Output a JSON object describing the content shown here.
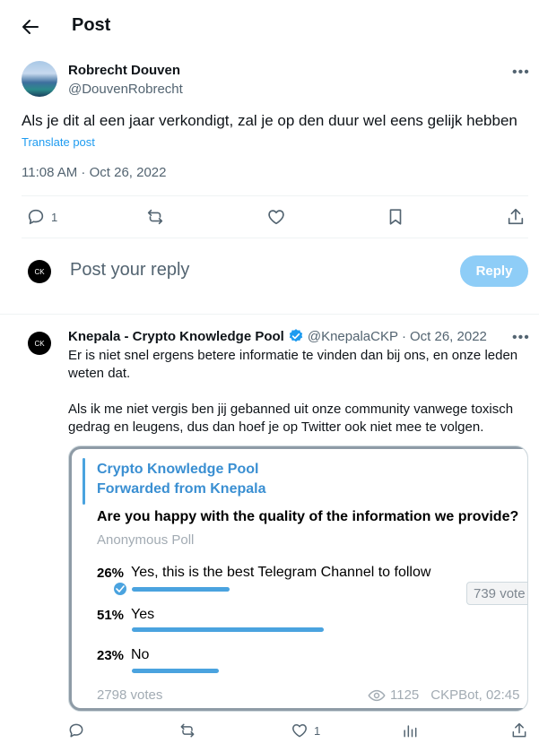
{
  "header": {
    "title": "Post"
  },
  "post": {
    "author_name": "Robrecht Douven",
    "author_handle": "@DouvenRobrecht",
    "text": "Als je dit al een jaar verkondigt, zal je op den duur wel eens gelijk hebben",
    "translate_label": "Translate post",
    "timestamp": "11:08 AM · Oct 26, 2022",
    "actions": {
      "reply_count": "1"
    }
  },
  "composer": {
    "avatar_text": "CK",
    "placeholder": "Post your reply",
    "reply_button": "Reply"
  },
  "reply": {
    "avatar_text": "CK",
    "name": "Knepala - Crypto Knowledge Pool",
    "handle": "@KnepalaCKP",
    "separator": "·",
    "date": "Oct 26, 2022",
    "paragraphs": [
      "Er is niet snel ergens betere informatie te vinden dan bij ons, en onze leden weten dat.",
      "Als ik me niet vergis ben jij gebanned uit onze community vanwege toxisch gedrag en leugens, dus dan hoef je op Twitter ook niet mee te volgen."
    ],
    "card": {
      "channel": "Crypto Knowledge Pool",
      "forwarded": "Forwarded from Knepala",
      "question": "Are you happy with the quality of the information we provide?",
      "poll_type": "Anonymous Poll",
      "options": [
        {
          "percent_label": "26%",
          "label": "Yes, this is the best Telegram Channel to follow",
          "fraction": 0.26,
          "selected": true
        },
        {
          "percent_label": "51%",
          "label": "Yes",
          "fraction": 0.51,
          "selected": false
        },
        {
          "percent_label": "23%",
          "label": "No",
          "fraction": 0.23,
          "selected": false
        }
      ],
      "tooltip": "739 vote",
      "total_votes": "2798 votes",
      "views": "1125",
      "signature": "CKPBot, 02:45",
      "accent_color": "#4aa3df"
    },
    "actions": {
      "like_count": "1"
    }
  },
  "icons": {
    "back": "arrow-left-icon",
    "more": "more-icon",
    "reply": "reply-icon",
    "repost": "repost-icon",
    "like": "heart-icon",
    "bookmark": "bookmark-icon",
    "share": "share-icon",
    "views": "views-icon",
    "eye": "eye-icon",
    "verified": "verified-icon"
  }
}
